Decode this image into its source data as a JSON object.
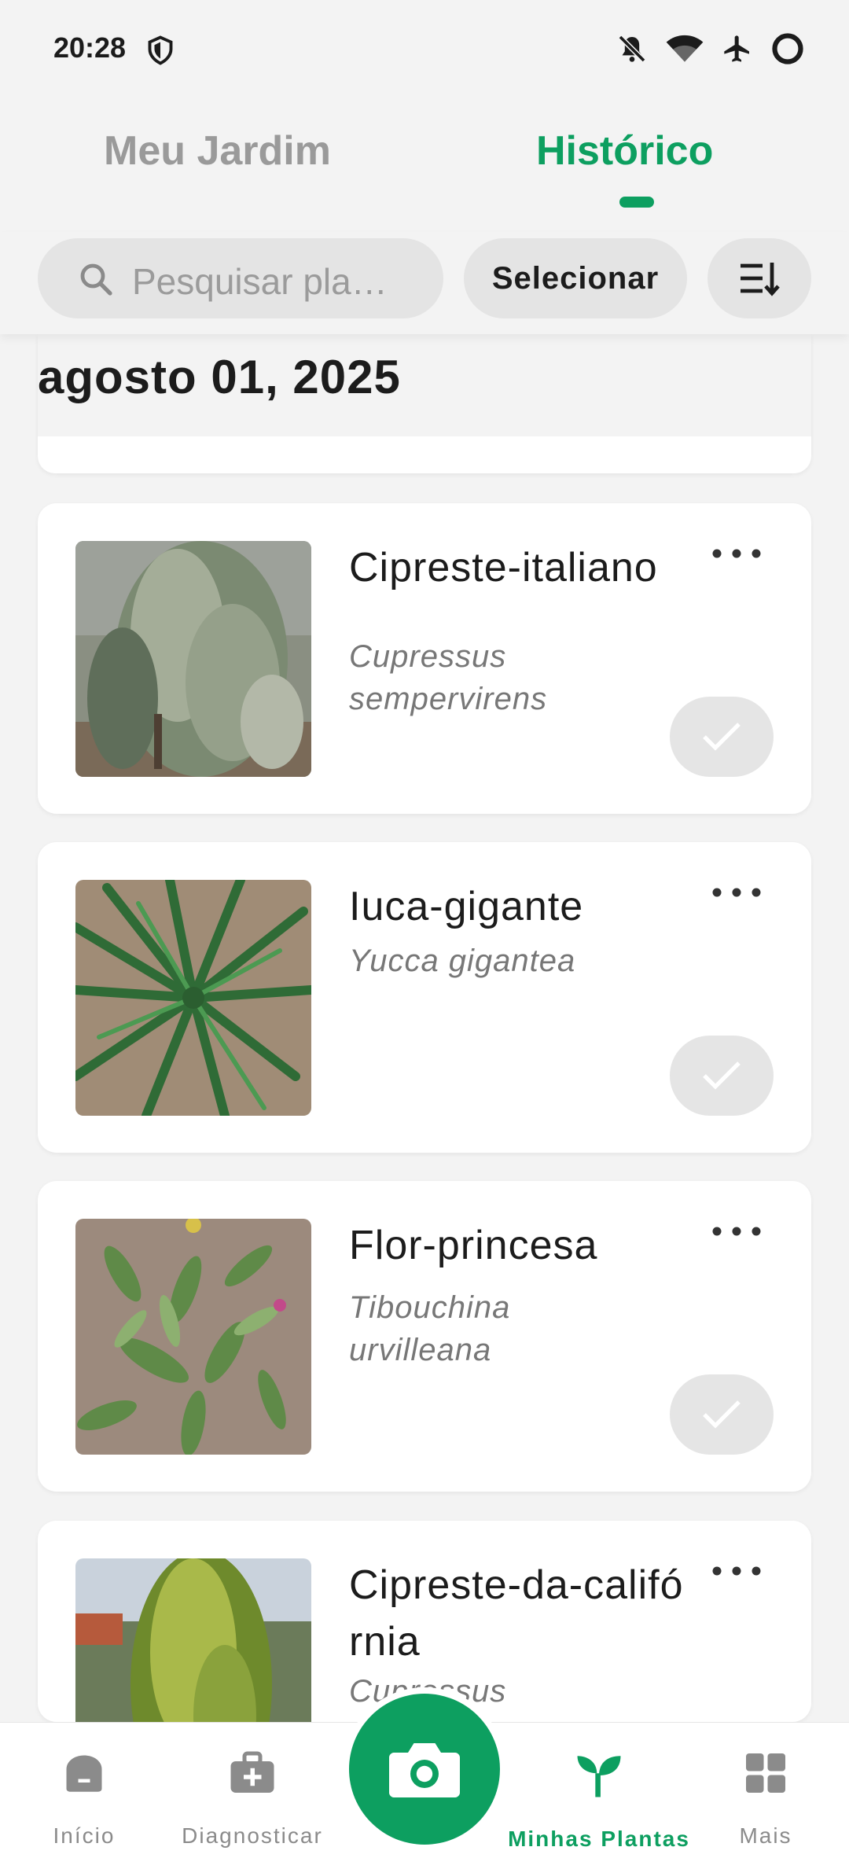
{
  "status_bar": {
    "time": "20:28"
  },
  "tabs": [
    {
      "label": "Meu Jardim",
      "active": false
    },
    {
      "label": "Histórico",
      "active": true
    }
  ],
  "toolbar": {
    "search_placeholder": "Pesquisar pla…",
    "select_label": "Selecionar"
  },
  "date_header": "agosto 01, 2025",
  "plants": [
    {
      "common_name": "Cipreste-italiano",
      "scientific_name": "Cupressus sempervirens"
    },
    {
      "common_name": "Iuca-gigante",
      "scientific_name": "Yucca gigantea"
    },
    {
      "common_name": "Flor-princesa",
      "scientific_name": "Tibouchina urvilleana"
    },
    {
      "common_name": "Cipreste-da-califórnia",
      "scientific_name": "Cupressus"
    }
  ],
  "bottom_nav": [
    {
      "label": "Início",
      "active": false
    },
    {
      "label": "Diagnosticar",
      "active": false
    },
    {
      "label": "Minhas Plantas",
      "active": true
    },
    {
      "label": "Mais",
      "active": false
    }
  ],
  "colors": {
    "accent": "#0d9f60",
    "inactive": "#8b8b8b",
    "background": "#f3f3f3"
  }
}
